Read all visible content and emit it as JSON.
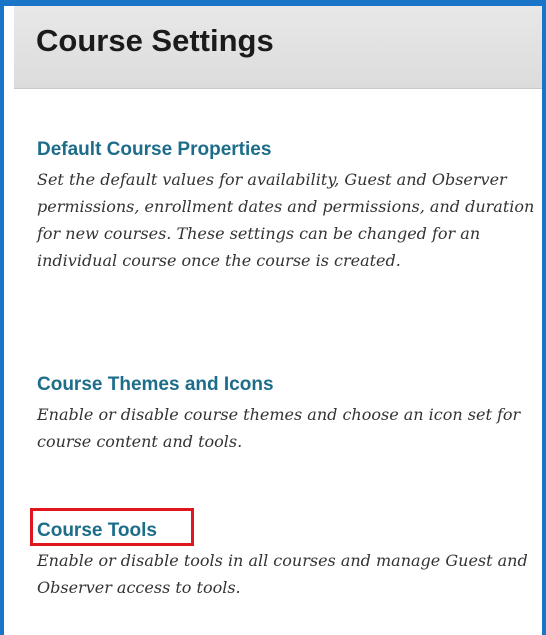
{
  "page": {
    "title": "Course Settings"
  },
  "sections": [
    {
      "link": "Default Course Properties",
      "description": "Set the default values for availability, Guest and Observer permissions, enrollment dates and permissions, and duration for new courses. These settings can be changed for an individual course once the course is created."
    },
    {
      "link": "Course Themes and Icons",
      "description": "Enable or disable course themes and choose an icon set for course content and tools."
    },
    {
      "link": "Course Tools",
      "description": "Enable or disable tools in all courses and manage Guest and Observer access to tools."
    }
  ],
  "colors": {
    "frame": "#1a74c7",
    "link": "#1d6d8a",
    "highlight": "#e0161e"
  }
}
